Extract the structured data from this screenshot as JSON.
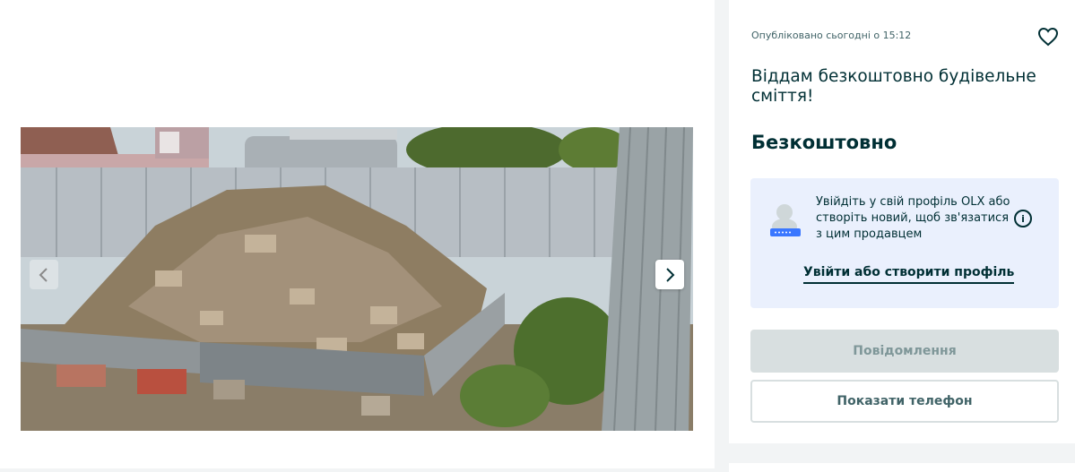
{
  "listing": {
    "published": "Опубліковано сьогодні о 15:12",
    "title": "Віддам безкоштовно будівельне сміття!",
    "price": "Безкоштовно"
  },
  "icons": {
    "favorite": "heart-icon",
    "info": "info-icon",
    "prev": "chevron-left-icon",
    "next": "chevron-right-icon"
  },
  "login_prompt": {
    "text": "Увійдіть у свій профіль OLX або створіть новий, щоб зв'язатися з цим продавцем",
    "info_glyph": "i",
    "link": "Увійти або створити профіль"
  },
  "actions": {
    "message": "Повідомлення",
    "show_phone": "Показати телефон"
  },
  "colors": {
    "primary_text": "#002f34",
    "disabled_button": "#d8dfe0",
    "login_box_bg": "#eaf0fd"
  }
}
